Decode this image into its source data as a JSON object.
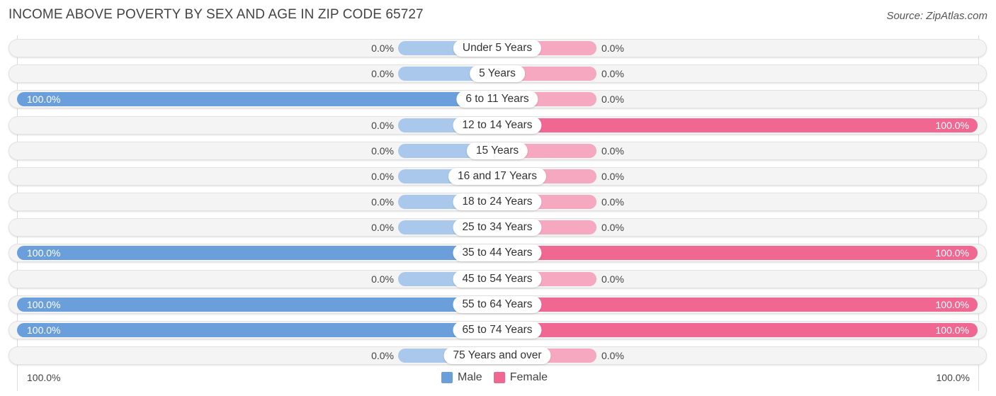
{
  "title": "INCOME ABOVE POVERTY BY SEX AND AGE IN ZIP CODE 65727",
  "source": "Source: ZipAtlas.com",
  "colors": {
    "male": "#6a9fdc",
    "male_light": "#a9c8ec",
    "female": "#f06792",
    "female_light": "#f6a8c0"
  },
  "axis": {
    "left_label": "100.0%",
    "right_label": "100.0%"
  },
  "legend": [
    {
      "label": "Male",
      "color": "#6a9fdc"
    },
    {
      "label": "Female",
      "color": "#f06792"
    }
  ],
  "chart_data": {
    "type": "bar",
    "orientation": "horizontal-diverging",
    "title": "INCOME ABOVE POVERTY BY SEX AND AGE IN ZIP CODE 65727",
    "xlabel": "",
    "ylabel": "",
    "xlim": [
      -100,
      100
    ],
    "legend_position": "bottom-center",
    "categories": [
      "Under 5 Years",
      "5 Years",
      "6 to 11 Years",
      "12 to 14 Years",
      "15 Years",
      "16 and 17 Years",
      "18 to 24 Years",
      "25 to 34 Years",
      "35 to 44 Years",
      "45 to 54 Years",
      "55 to 64 Years",
      "65 to 74 Years",
      "75 Years and over"
    ],
    "series": [
      {
        "name": "Male",
        "values": [
          0,
          0,
          100,
          0,
          0,
          0,
          0,
          0,
          100,
          0,
          100,
          100,
          0
        ],
        "labels": [
          "0.0%",
          "0.0%",
          "100.0%",
          "0.0%",
          "0.0%",
          "0.0%",
          "0.0%",
          "0.0%",
          "100.0%",
          "0.0%",
          "100.0%",
          "100.0%",
          "0.0%"
        ]
      },
      {
        "name": "Female",
        "values": [
          0,
          0,
          0,
          100,
          0,
          0,
          0,
          0,
          100,
          0,
          100,
          100,
          0
        ],
        "labels": [
          "0.0%",
          "0.0%",
          "0.0%",
          "100.0%",
          "0.0%",
          "0.0%",
          "0.0%",
          "0.0%",
          "100.0%",
          "0.0%",
          "100.0%",
          "100.0%",
          "0.0%"
        ]
      }
    ]
  }
}
